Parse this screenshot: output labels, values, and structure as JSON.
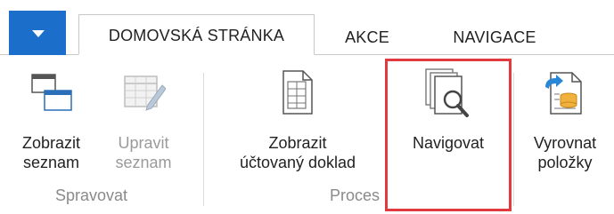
{
  "tabs": {
    "home": "DOMOVSKÁ STRÁNKA",
    "actions": "AKCE",
    "navigation": "NAVIGACE"
  },
  "groups": {
    "manage": "Spravovat",
    "process": "Proces"
  },
  "buttons": {
    "show_list_1": "Zobrazit",
    "show_list_2": "seznam",
    "edit_list_1": "Upravit",
    "edit_list_2": "seznam",
    "show_posted_1": "Zobrazit",
    "show_posted_2": "účtovaný doklad",
    "navigate": "Navigovat",
    "apply_1": "Vyrovnat",
    "apply_2": "položky"
  },
  "colors": {
    "accent": "#1b6fcb",
    "highlight": "#e0393e"
  },
  "icons": [
    "chevron-down-icon",
    "show-list-icon",
    "edit-list-icon",
    "posted-document-icon",
    "navigate-icon",
    "apply-entries-icon"
  ]
}
